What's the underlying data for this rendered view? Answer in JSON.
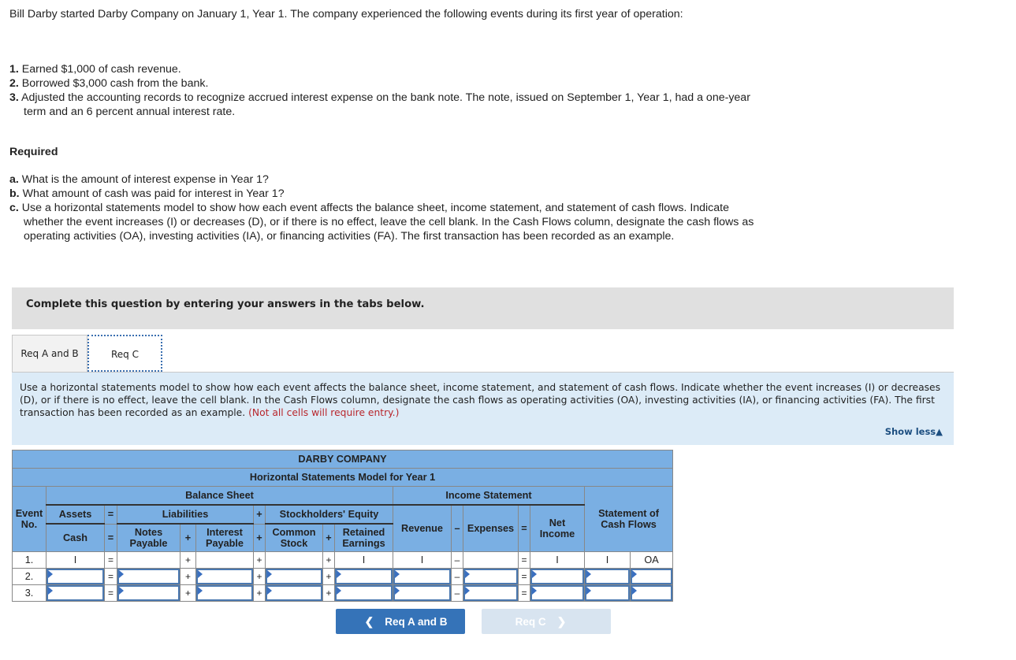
{
  "intro": {
    "text": "Bill Darby started Darby Company on January 1, Year 1. The company experienced the following events during its first year of operation:"
  },
  "events": [
    {
      "num": "1.",
      "text": "Earned $1,000 of cash revenue."
    },
    {
      "num": "2.",
      "text": "Borrowed $3,000 cash from the bank."
    },
    {
      "num": "3.",
      "text": "Adjusted the accounting records to recognize accrued interest expense on the bank note. The note, issued on September 1, Year 1, had a one-year term and an 6 percent annual interest rate."
    }
  ],
  "required": {
    "heading": "Required",
    "items": [
      {
        "label": "a.",
        "text": "What is the amount of interest expense in Year 1?"
      },
      {
        "label": "b.",
        "text": "What amount of cash was paid for interest in Year 1?"
      },
      {
        "label": "c.",
        "text": "Use a horizontal statements model to show how each event affects the balance sheet, income statement, and statement of cash flows. Indicate whether the event increases (I) or decreases (D), or if there is no effect, leave the cell blank. In the Cash Flows column, designate the cash flows as operating activities (OA), investing activities (IA), or financing activities (FA). The first transaction has been recorded as an example."
      }
    ]
  },
  "instruction_bar": "Complete this question by entering your answers in the tabs below.",
  "tabs": [
    {
      "label": "Req A and B",
      "active": false
    },
    {
      "label": "Req C",
      "active": true
    }
  ],
  "panel": {
    "text": "Use a horizontal statements model to show how each event affects the balance sheet, income statement, and statement of cash flows. Indicate whether the event increases (I) or decreases (D), or if there is no effect, leave the cell blank. In the Cash Flows column, designate the cash flows as operating activities (OA), investing activities (IA), or financing activities (FA). The first transaction has been recorded as an example.",
    "note": "(Not all cells will require entry.)",
    "show_less": "Show less",
    "show_less_icon": "triangle-up"
  },
  "table": {
    "company": "DARBY COMPANY",
    "subtitle": "Horizontal Statements Model for Year 1",
    "balance_sheet": "Balance Sheet",
    "income_statement": "Income Statement",
    "cash_flows": "Statement of Cash Flows",
    "event_no": "Event No.",
    "assets": "Assets",
    "liabilities": "Liabilities",
    "equity": "Stockholders' Equity",
    "cash": "Cash",
    "notes_payable": "Notes Payable",
    "interest_payable": "Interest Payable",
    "common_stock": "Common Stock",
    "retained_earnings": "Retained Earnings",
    "revenue": "Revenue",
    "expenses": "Expenses",
    "net_income": "Net Income",
    "ops": {
      "eq": "=",
      "plus": "+",
      "minus": "–"
    },
    "rows": [
      {
        "event": "1.",
        "cash": "I",
        "notes_payable": "",
        "interest_payable": "",
        "common_stock": "",
        "retained_earnings": "I",
        "revenue": "I",
        "expenses": "",
        "net_income": "I",
        "cf_amount": "I",
        "cf_activity": "OA",
        "editable": false
      },
      {
        "event": "2.",
        "cash": "",
        "notes_payable": "",
        "interest_payable": "",
        "common_stock": "",
        "retained_earnings": "",
        "revenue": "",
        "expenses": "",
        "net_income": "",
        "cf_amount": "",
        "cf_activity": "",
        "editable": true
      },
      {
        "event": "3.",
        "cash": "",
        "notes_payable": "",
        "interest_payable": "",
        "common_stock": "",
        "retained_earnings": "",
        "revenue": "",
        "expenses": "",
        "net_income": "",
        "cf_amount": "",
        "cf_activity": "",
        "editable": true
      }
    ]
  },
  "nav": {
    "prev_label": "Req A and B",
    "next_label": "Req C",
    "next_disabled": true
  }
}
